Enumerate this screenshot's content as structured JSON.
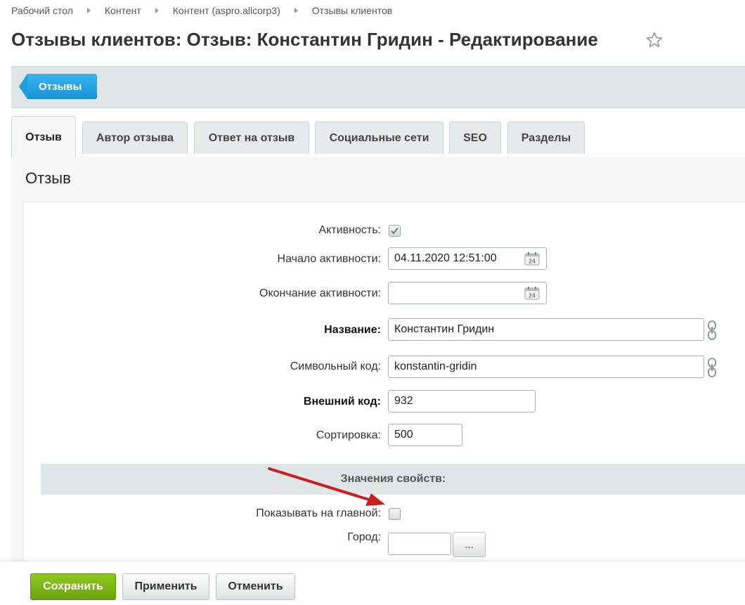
{
  "breadcrumb": {
    "items": [
      "Рабочий стол",
      "Контент",
      "Контент (aspro.allcorp3)",
      "Отзывы клиентов"
    ]
  },
  "page": {
    "title": "Отзывы клиентов: Отзыв: Константин Гридин - Редактирование"
  },
  "toolbar": {
    "back_label": "Отзывы"
  },
  "tabs": [
    {
      "label": "Отзыв",
      "active": true
    },
    {
      "label": "Автор отзыва",
      "active": false
    },
    {
      "label": "Ответ на отзыв",
      "active": false
    },
    {
      "label": "Социальные сети",
      "active": false
    },
    {
      "label": "SEO",
      "active": false
    },
    {
      "label": "Разделы",
      "active": false
    }
  ],
  "section": {
    "title": "Отзыв"
  },
  "form": {
    "active_label": "Активность:",
    "active_checked": true,
    "start_label": "Начало активности:",
    "start_value": "04.11.2020 12:51:00",
    "end_label": "Окончание активности:",
    "end_value": "",
    "name_label": "Название:",
    "name_value": "Константин Гридин",
    "code_label": "Символьный код:",
    "code_value": "konstantin-gridin",
    "xml_label": "Внешний код:",
    "xml_value": "932",
    "sort_label": "Сортировка:",
    "sort_value": "500",
    "props_header": "Значения свойств:",
    "show_main_label": "Показывать на главной:",
    "show_main_checked": false,
    "city_label": "Город:",
    "city_value": "",
    "city_button": "..."
  },
  "footer": {
    "save": "Сохранить",
    "apply": "Применить",
    "cancel": "Отменить"
  },
  "colors": {
    "accent": "#1693d6",
    "save_green": "#7cb414",
    "annotation_arrow": "#c8201e"
  },
  "icons": {
    "favorite": "star-icon",
    "calendar": "calendar-icon",
    "translit": "link-icon",
    "annotation": "arrow-annotation"
  }
}
